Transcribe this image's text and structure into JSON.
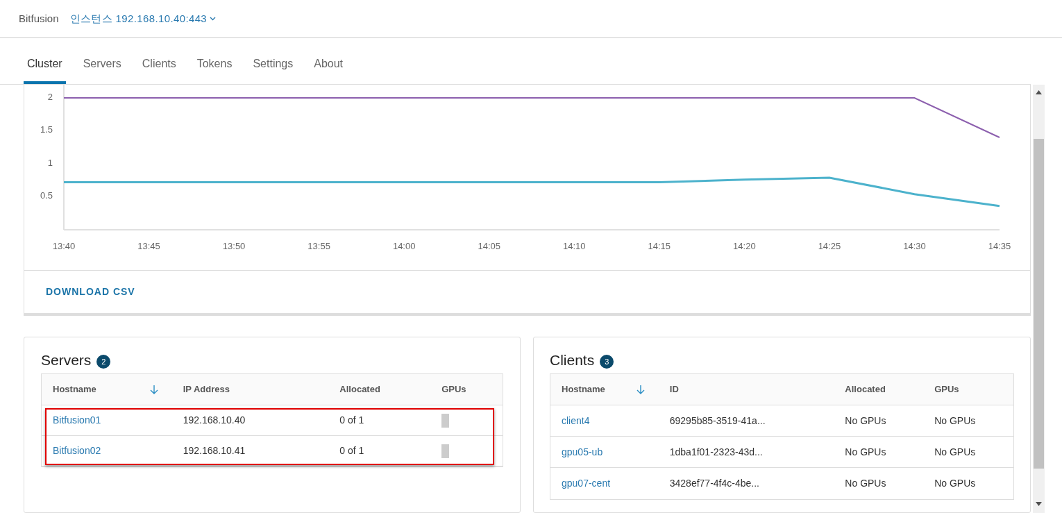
{
  "header": {
    "app_name": "Bitfusion",
    "instance": "인스턴스 192.168.10.40:443"
  },
  "tabs": [
    {
      "label": "Cluster",
      "selected": true
    },
    {
      "label": "Servers",
      "selected": false
    },
    {
      "label": "Clients",
      "selected": false
    },
    {
      "label": "Tokens",
      "selected": false
    },
    {
      "label": "Settings",
      "selected": false
    },
    {
      "label": "About",
      "selected": false
    }
  ],
  "chart": {
    "chart_data": {
      "type": "line",
      "x": [
        "13:40",
        "13:45",
        "13:50",
        "13:55",
        "14:00",
        "14:05",
        "14:10",
        "14:15",
        "14:20",
        "14:25",
        "14:30",
        "14:35"
      ],
      "ylim": [
        0,
        2.2
      ],
      "yticks": [
        0.5,
        1,
        1.5,
        2
      ],
      "series": [
        {
          "color": "#8c5fae",
          "values": [
            2,
            2,
            2,
            2,
            2,
            2,
            2,
            2,
            2,
            2,
            2,
            1.4
          ]
        },
        {
          "color": "#4cb2cc",
          "values": [
            0.72,
            0.72,
            0.72,
            0.72,
            0.72,
            0.72,
            0.72,
            0.72,
            0.76,
            0.79,
            0.54,
            0.36
          ]
        }
      ]
    },
    "download_label": "DOWNLOAD CSV"
  },
  "servers": {
    "title": "Servers",
    "count": "2",
    "highlighted": true,
    "columns": [
      "Hostname",
      "IP Address",
      "Allocated",
      "GPUs"
    ],
    "rows": [
      {
        "hostname": "Bitfusion01",
        "ip": "192.168.10.40",
        "allocated": "0 of 1"
      },
      {
        "hostname": "Bitfusion02",
        "ip": "192.168.10.41",
        "allocated": "0 of 1"
      }
    ]
  },
  "clients": {
    "title": "Clients",
    "count": "3",
    "columns": [
      "Hostname",
      "ID",
      "Allocated",
      "GPUs"
    ],
    "rows": [
      {
        "hostname": "client4",
        "id": "69295b85-3519-41a...",
        "allocated": "No GPUs",
        "gpus": "No GPUs"
      },
      {
        "hostname": "gpu05-ub",
        "id": "1dba1f01-2323-43d...",
        "allocated": "No GPUs",
        "gpus": "No GPUs"
      },
      {
        "hostname": "gpu07-cent",
        "id": "3428ef77-4f4c-4be...",
        "allocated": "No GPUs",
        "gpus": "No GPUs"
      }
    ]
  }
}
